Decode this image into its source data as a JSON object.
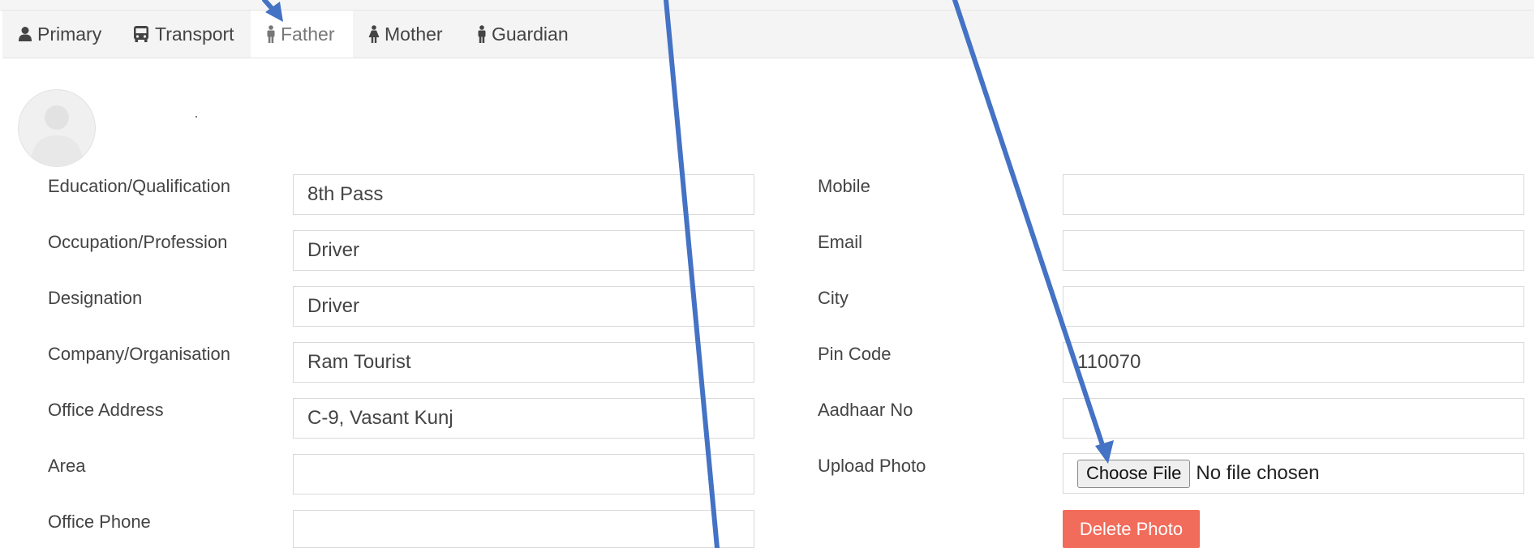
{
  "tabs": [
    {
      "label": "Primary",
      "icon": "user-icon"
    },
    {
      "label": "Transport",
      "icon": "bus-icon"
    },
    {
      "label": "Father",
      "icon": "male-icon"
    },
    {
      "label": "Mother",
      "icon": "female-icon"
    },
    {
      "label": "Guardian",
      "icon": "male-icon"
    }
  ],
  "active_tab": "Father",
  "profile": {
    "name_dot": "."
  },
  "left_fields": [
    {
      "label": "Education/Qualification",
      "value": "8th Pass"
    },
    {
      "label": "Occupation/Profession",
      "value": "Driver"
    },
    {
      "label": "Designation",
      "value": "Driver"
    },
    {
      "label": "Company/Organisation",
      "value": "Ram Tourist"
    },
    {
      "label": "Office Address",
      "value": "C-9, Vasant Kunj"
    },
    {
      "label": "Area",
      "value": ""
    },
    {
      "label": "Office Phone",
      "value": ""
    }
  ],
  "right_fields": [
    {
      "label": "Mobile",
      "value": ""
    },
    {
      "label": "Email",
      "value": ""
    },
    {
      "label": "City",
      "value": ""
    },
    {
      "label": "Pin Code",
      "value": "110070"
    },
    {
      "label": "Aadhaar No",
      "value": ""
    }
  ],
  "upload": {
    "label": "Upload Photo",
    "button_label": "Choose File",
    "status": "No file chosen"
  },
  "delete_photo_label": "Delete Photo",
  "colors": {
    "annotation_arrow": "#4472c4",
    "delete_button": "#f26c5b"
  }
}
